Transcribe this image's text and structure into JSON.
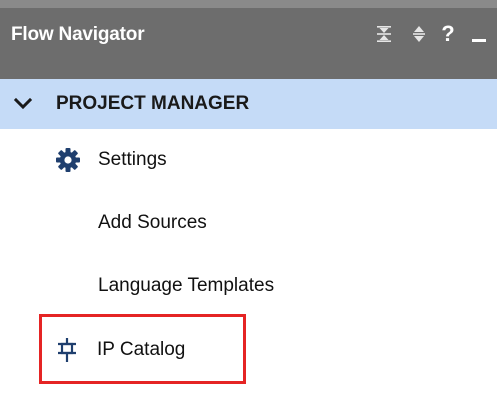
{
  "header": {
    "title": "Flow Navigator",
    "icons": [
      "collapse-all-icon",
      "expand-all-icon",
      "help-icon",
      "minimize-icon"
    ],
    "help_glyph": "?",
    "background": "#6d6d6d"
  },
  "section": {
    "label": "PROJECT MANAGER",
    "expanded": true,
    "background": "#c5dbf7"
  },
  "items": [
    {
      "label": "Settings",
      "icon": "gear-icon"
    },
    {
      "label": "Add Sources",
      "icon": null
    },
    {
      "label": "Language Templates",
      "icon": null
    },
    {
      "label": "IP Catalog",
      "icon": "ip-plug-icon",
      "highlighted": true
    }
  ],
  "highlight_color": "#e52424"
}
